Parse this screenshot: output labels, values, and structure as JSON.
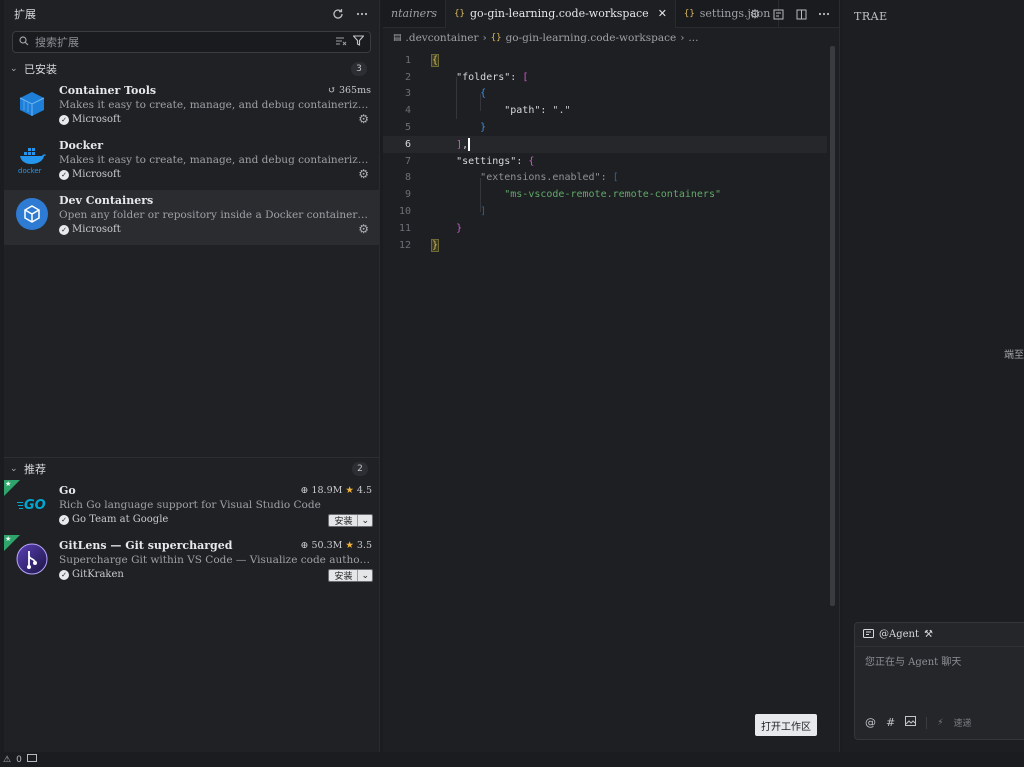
{
  "sidebar": {
    "title": "扩展",
    "search_placeholder": "搜索扩展",
    "installed": {
      "label": "已安装",
      "count": "3",
      "items": [
        {
          "name": "Container Tools",
          "desc": "Makes it easy to create, manage, and debug containerized applications.",
          "publisher": "Microsoft",
          "meta": "365ms",
          "icon": "container-tools-icon"
        },
        {
          "name": "Docker",
          "desc": "Makes it easy to create, manage, and debug containerized applications.",
          "publisher": "Microsoft",
          "icon": "docker-icon"
        },
        {
          "name": "Dev Containers",
          "desc": "Open any folder or repository inside a Docker container and take advantage of Visual Studio Code's full feature set.",
          "publisher": "Microsoft",
          "icon": "dev-containers-icon"
        }
      ]
    },
    "recommended": {
      "label": "推荐",
      "count": "2",
      "items": [
        {
          "name": "Go",
          "desc": "Rich Go language support for Visual Studio Code",
          "publisher": "Go Team at Google",
          "downloads": "18.9M",
          "rating": "4.5",
          "install_label": "安装",
          "icon": "go-icon"
        },
        {
          "name": "GitLens — Git supercharged",
          "desc": "Supercharge Git within VS Code — Visualize code authorship at a glance via Git blame annotations and CodeLens, seamlessly navigate and explore Git repositories",
          "publisher": "GitKraken",
          "downloads": "50.3M",
          "rating": "3.5",
          "install_label": "安装",
          "icon": "gitlens-icon"
        }
      ]
    }
  },
  "editor": {
    "tabs": [
      {
        "label": "ntainers"
      },
      {
        "label": "go-gin-learning.code-workspace",
        "active": true
      },
      {
        "label": "settings.json"
      }
    ],
    "breadcrumb": [
      ".devcontainer",
      "go-gin-learning.code-workspace",
      "..."
    ],
    "line_numbers": [
      "1",
      "2",
      "3",
      "4",
      "5",
      "6",
      "7",
      "8",
      "9",
      "10",
      "11",
      "12"
    ],
    "code": {
      "folders_key": "\"folders\"",
      "path_key": "\"path\"",
      "path_value": "\".\"",
      "settings_key": "\"settings\"",
      "ext_key": "\"extensions.enabled\"",
      "ext_value": "\"ms-vscode-remote.remote-containers\""
    },
    "open_workspace_button": "打开工作区"
  },
  "right_panel": {
    "brand": "TRAE",
    "side_text": "端至",
    "chat": {
      "agent_label": "@Agent",
      "placeholder": "您正在与 Agent 聊天",
      "send_hint": "速递"
    }
  },
  "status": {
    "warnings": "0"
  },
  "colors": {
    "bracket_gold": "#d9b85a",
    "bracket_magenta": "#c55ec8",
    "bracket_blue": "#3f8ee0",
    "string_green": "#62a86b",
    "badge_green": "#2fa56c"
  }
}
